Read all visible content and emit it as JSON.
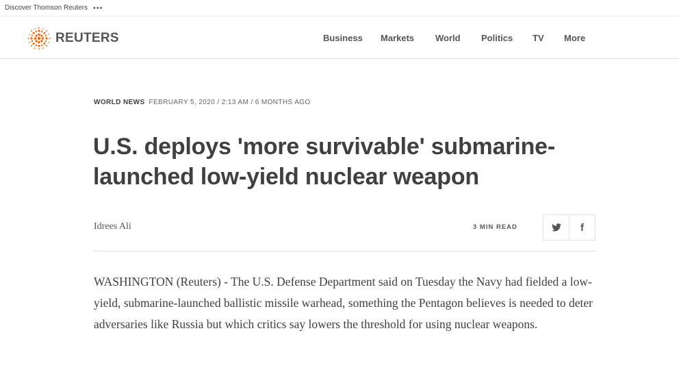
{
  "topbar": {
    "discover": "Discover Thomson Reuters",
    "more": "•••"
  },
  "header": {
    "brand": "REUTERS",
    "nav": [
      {
        "label": "Business"
      },
      {
        "label": "Markets"
      },
      {
        "label": "World"
      },
      {
        "label": "Politics"
      },
      {
        "label": "TV"
      },
      {
        "label": "More"
      }
    ]
  },
  "article": {
    "section": "WORLD NEWS",
    "dateline": "FEBRUARY 5, 2020 / 2:13 AM / 6 MONTHS AGO",
    "headline": "U.S. deploys 'more survivable' submarine-launched low-yield nuclear weapon",
    "author": "Idrees Ali",
    "read_time": "3 MIN READ",
    "share": {
      "twitter_icon": "twitter-icon",
      "facebook_icon": "facebook-icon",
      "twitter_glyph": "🐦",
      "facebook_glyph": "f"
    },
    "first_paragraph": "WASHINGTON (Reuters) - The U.S. Defense Department said on Tuesday the Navy had fielded a low-yield, submarine-launched ballistic missile warhead, something the Pentagon believes is needed to deter adversaries like Russia but which critics say lowers the threshold for using nuclear weapons."
  },
  "colors": {
    "brand_orange": "#fa6400",
    "text": "#404040",
    "border": "#e2e2e2"
  }
}
